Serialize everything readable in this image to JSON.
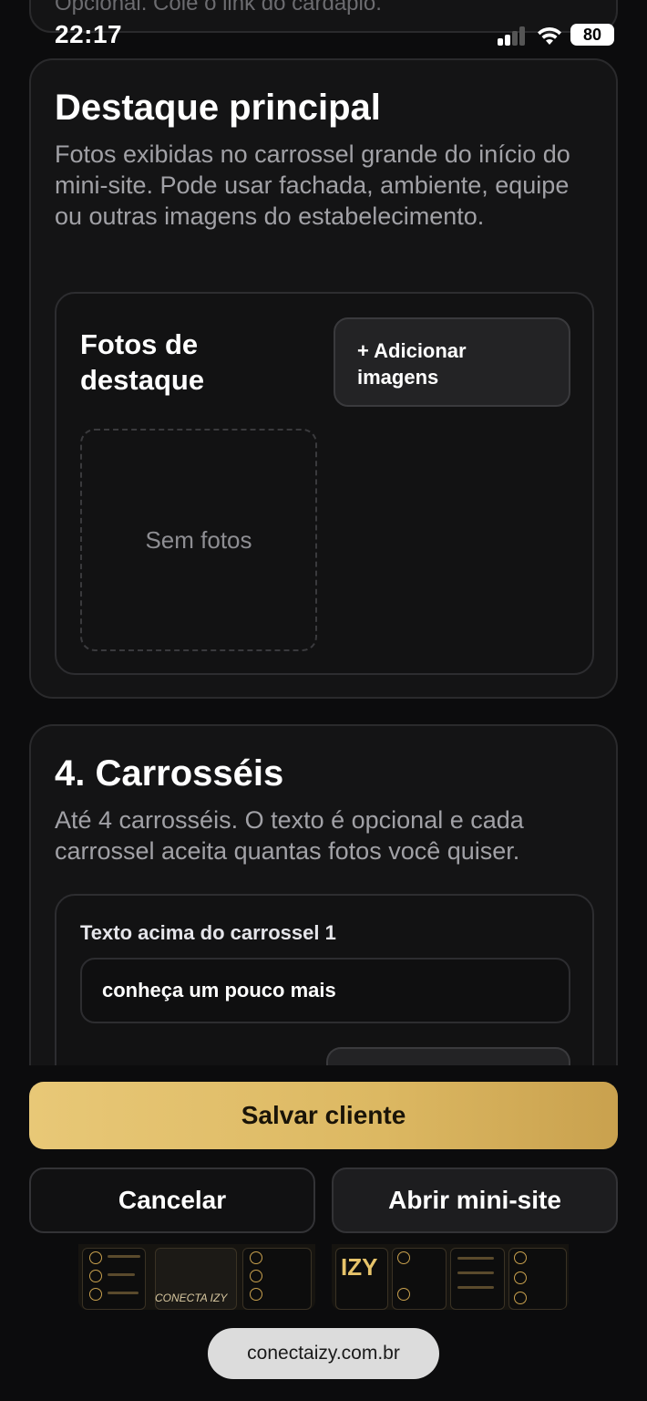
{
  "status_bar": {
    "time": "22:17",
    "battery": "80"
  },
  "previous_card": {
    "text": "Opcional. Cole o link do cardápio."
  },
  "highlight": {
    "title": "Destaque principal",
    "description": "Fotos exibidas no carrossel grande do início do mini-site. Pode usar fachada, ambiente, equipe ou outras imagens do estabelecimento.",
    "photos_label": "Fotos de destaque",
    "add_button": "+ Adicionar imagens",
    "empty_text": "Sem fotos"
  },
  "carousels": {
    "title": "4. Carrosséis",
    "description": "Até 4 carrosséis. O texto é opcional e cada carrossel aceita quantas fotos você quiser.",
    "item1": {
      "label": "Texto acima do carrossel 1",
      "value": "conheça um pouco mais"
    }
  },
  "actions": {
    "save": "Salvar cliente",
    "cancel": "Cancelar",
    "open_site": "Abrir mini-site"
  },
  "thumbnails": {
    "brand1": "CONECTA IZY",
    "brand2": "IZY"
  },
  "browser": {
    "url": "conectaizy.com.br"
  },
  "colors": {
    "accent_gold": "#dcb862",
    "card_bg": "#141415",
    "page_bg": "#0c0c0d"
  }
}
